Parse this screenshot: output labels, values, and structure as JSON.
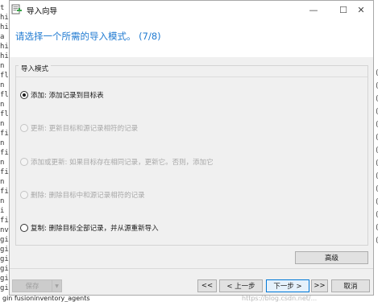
{
  "window": {
    "title": "导入向导",
    "minimize_glyph": "—",
    "maximize_glyph": "☐",
    "close_glyph": "✕"
  },
  "header": {
    "title": "请选择一个所需的导入模式。 (7/8)"
  },
  "import_mode": {
    "legend": "导入模式",
    "options": [
      {
        "label": "添加: 添加记录到目标表",
        "selected": true,
        "enabled": true
      },
      {
        "label": "更新: 更新目标和源记录相符的记录",
        "selected": false,
        "enabled": false
      },
      {
        "label": "添加或更新: 如果目标存在相同记录，更新它。否则，添加它",
        "selected": false,
        "enabled": false
      },
      {
        "label": "删除: 删除目标中和源记录相符的记录",
        "selected": false,
        "enabled": false
      },
      {
        "label": "复制: 删除目标全部记录，并从源重新导入",
        "selected": false,
        "enabled": true
      }
    ]
  },
  "buttons": {
    "advanced": "高级",
    "save": "保存",
    "save_dropdown_glyph": "▼",
    "first": "<<",
    "prev": "< 上一步",
    "next": "下一步 >",
    "last": ">>",
    "cancel": "取消"
  },
  "background": {
    "left_fragments": [
      "t",
      "hi",
      "hi",
      "a",
      "hi",
      "hi",
      "n",
      "fl",
      "n",
      "fl",
      "n",
      "fl",
      "n",
      "fi",
      "n",
      "fi",
      "n",
      "fi",
      "n",
      "fi",
      "n",
      "i",
      "fi",
      "nv",
      "gi",
      "gi",
      "gi",
      "gi",
      "gi",
      "gi"
    ],
    "right_fragments": [
      "(",
      "(",
      "(",
      "(",
      "(",
      "(",
      "(",
      "(",
      "(",
      "(",
      "(",
      "(",
      "(",
      "("
    ],
    "bottom_text": "gin fusioninventory_agents",
    "watermark": "https://blog.csdn.net/..."
  },
  "colors": {
    "header_title": "#1f7ad1",
    "dialog_bg": "#f0f0f0",
    "primary_border": "#0078d7"
  }
}
